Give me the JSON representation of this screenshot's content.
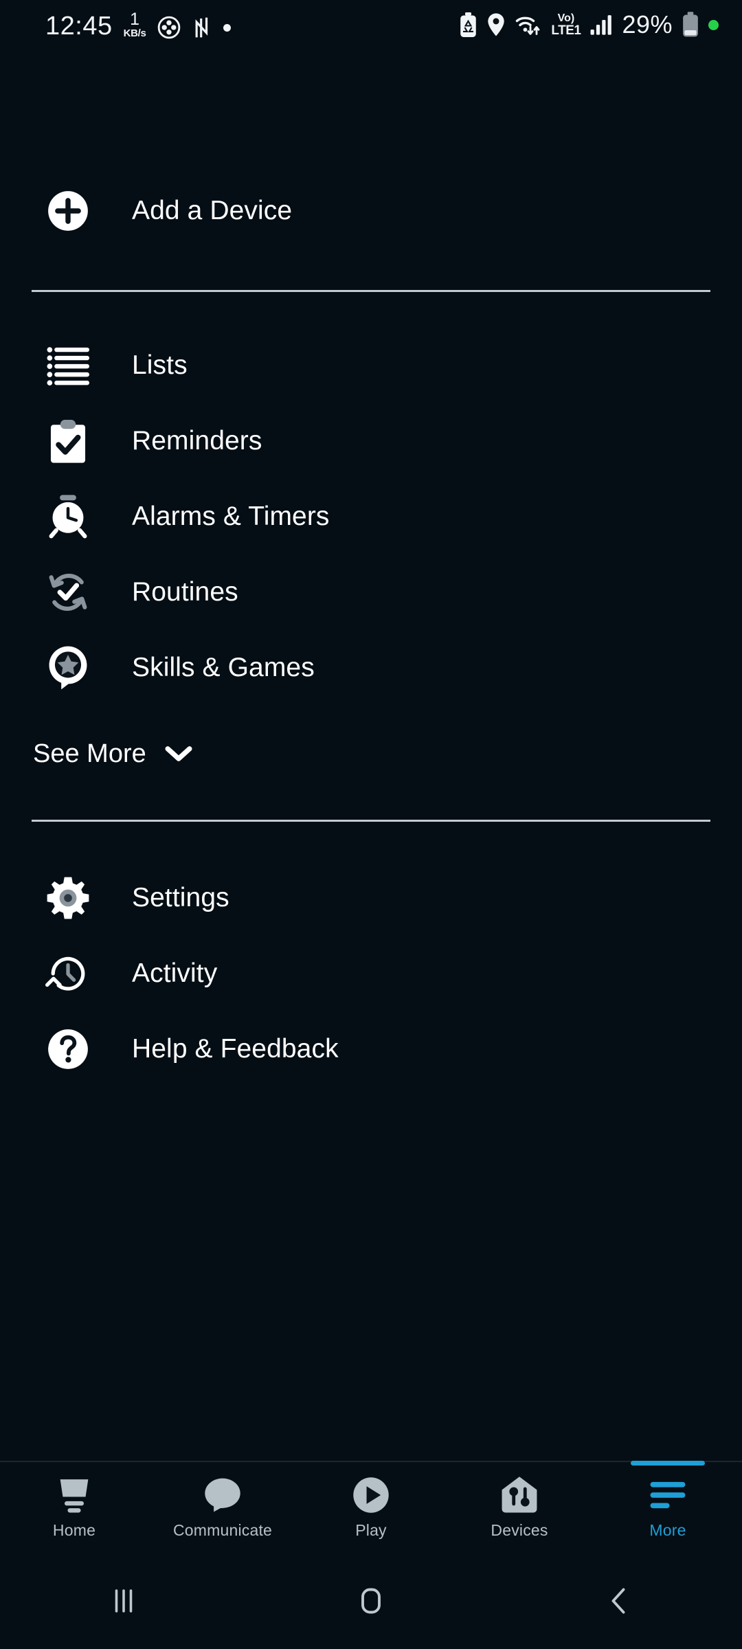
{
  "status_bar": {
    "time": "12:45",
    "net_speed_value": "1",
    "net_speed_unit": "KB/s",
    "icons_left": [
      "accessibility-icon",
      "nfc-icon",
      "dot-indicator-icon"
    ],
    "battery_saver_icon": "battery-saver-icon",
    "location_icon": "location-pin-icon",
    "wifi_icon": "wifi-transfer-icon",
    "volte_line1": "Vo)",
    "volte_line2": "LTE1",
    "signal_icon": "cellular-signal-icon",
    "battery_percent": "29%",
    "battery_icon": "battery-icon",
    "recording_dot": "green-dot-icon"
  },
  "menu": {
    "add_device": {
      "label": "Add a Device",
      "icon": "plus-circle-icon"
    },
    "primary_items": [
      {
        "label": "Lists",
        "icon": "list-bullets-icon"
      },
      {
        "label": "Reminders",
        "icon": "clipboard-check-icon"
      },
      {
        "label": "Alarms & Timers",
        "icon": "alarm-clock-icon"
      },
      {
        "label": "Routines",
        "icon": "refresh-check-icon"
      },
      {
        "label": "Skills & Games",
        "icon": "speech-bubble-star-icon"
      }
    ],
    "see_more": {
      "label": "See More",
      "icon": "chevron-down-icon"
    },
    "secondary_items": [
      {
        "label": "Settings",
        "icon": "gear-icon"
      },
      {
        "label": "Activity",
        "icon": "clock-history-icon"
      },
      {
        "label": "Help & Feedback",
        "icon": "question-circle-icon"
      }
    ]
  },
  "tab_bar": {
    "active_index": 4,
    "tabs": [
      {
        "label": "Home",
        "icon": "echo-device-icon"
      },
      {
        "label": "Communicate",
        "icon": "speech-bubble-icon"
      },
      {
        "label": "Play",
        "icon": "play-circle-icon"
      },
      {
        "label": "Devices",
        "icon": "home-sliders-icon"
      },
      {
        "label": "More",
        "icon": "hamburger-menu-icon"
      }
    ]
  },
  "nav_bar": {
    "recents": "recents-icon",
    "home": "home-square-icon",
    "back": "back-chevron-icon"
  },
  "colors": {
    "background": "#060e15",
    "accent": "#1e9fd6",
    "icon_white": "#ffffff",
    "icon_gray": "#8a949c",
    "text_primary": "#ffffff",
    "tab_inactive": "#b6c0c7",
    "divider": "#c3cbd1"
  }
}
